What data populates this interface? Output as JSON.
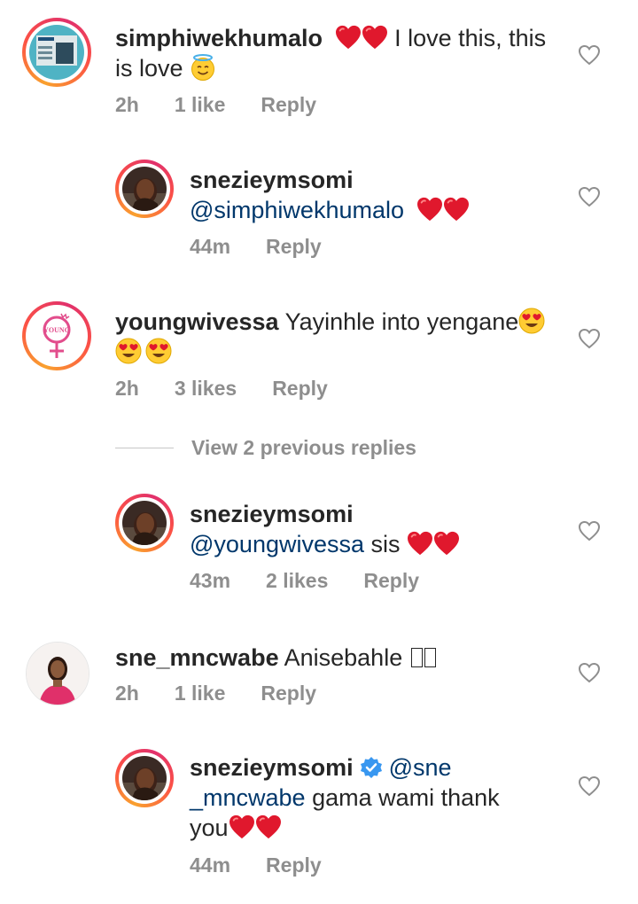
{
  "comments": [
    {
      "username": "simphiwekhumalo",
      "text_after_hearts": " I love this, this",
      "text_line2": "is love",
      "time": "2h",
      "likes": "1 like",
      "reply_label": "Reply"
    },
    {
      "username": "snezieymsomi",
      "mention": "@simphiwekhumalo",
      "time": "44m",
      "reply_label": "Reply"
    },
    {
      "username": "youngwivessa",
      "text": " Yayinhle into yengane",
      "time": "2h",
      "likes": "3 likes",
      "reply_label": "Reply"
    },
    {
      "username": "snezieymsomi",
      "mention": "@youngwivessa",
      "text": " sis ",
      "time": "43m",
      "likes": "2 likes",
      "reply_label": "Reply"
    },
    {
      "username": "sne_mncwabe",
      "text": " Anisebahle ",
      "time": "2h",
      "likes": "1 like",
      "reply_label": "Reply"
    },
    {
      "username": "snezieymsomi",
      "mention_part1": "@sne",
      "mention_part2": "_mncwabe",
      "text_line2": " gama wami thank",
      "text_line3": "you",
      "time": "44m",
      "reply_label": "Reply"
    }
  ],
  "view_previous_replies": "View 2 previous replies",
  "youngwives_logo_text": "YOUNG",
  "colors": {
    "heart_emoji": "#e0182d",
    "mention": "#00376b",
    "meta": "#8e8e8e",
    "verified": "#3897f0"
  }
}
